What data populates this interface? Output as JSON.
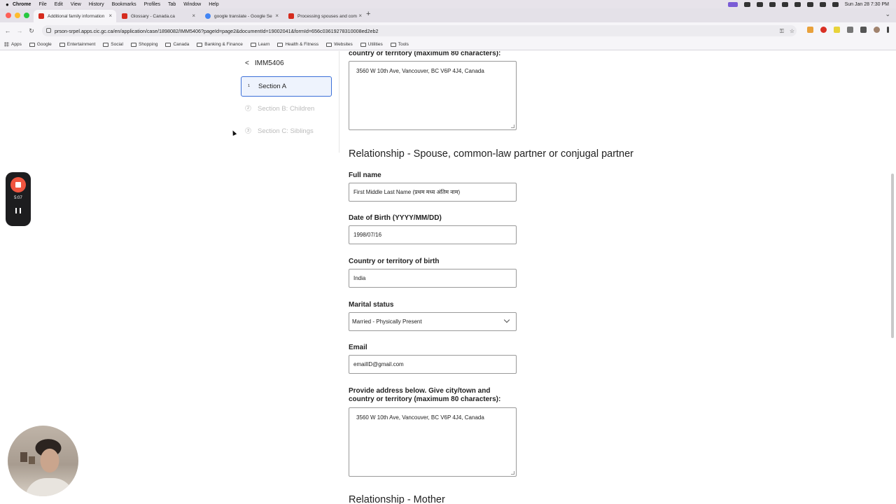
{
  "macbar": {
    "app": "Chrome",
    "menus": [
      "File",
      "Edit",
      "View",
      "History",
      "Bookmarks",
      "Profiles",
      "Tab",
      "Window",
      "Help"
    ],
    "clock": "Sun Jan 28  7:30 PM"
  },
  "tabs": [
    {
      "label": "Additional family information",
      "favicon_color": "#d52b1e"
    },
    {
      "label": "Glossary - Canada.ca",
      "favicon_color": "#d52b1e"
    },
    {
      "label": "google translate - Google Se",
      "favicon_color": "#4285f4"
    },
    {
      "label": "Processing spouses and com",
      "favicon_color": "#d52b1e"
    }
  ],
  "url": "prson-srpel.apps.cic.gc.ca/en/application/case/1898082/IMM5406?pageId=page2&documentId=19002041&formId=656c03619278310008ed2eb2",
  "bookmarks": [
    "Apps",
    "Google",
    "Entertainment",
    "Social",
    "Shopping",
    "Canada",
    "Learn",
    "Banking & Finance",
    "Health & Fitness",
    "Websites",
    "Utilities",
    "Tools"
  ],
  "sidebar": {
    "back_label": "IMM5406",
    "steps": [
      {
        "num": "1",
        "label": "Section A"
      },
      {
        "num": "2",
        "label": "Section B: Children"
      },
      {
        "num": "3",
        "label": "Section C: Siblings"
      }
    ]
  },
  "form": {
    "top_address_label": "country or territory (maximum 80 characters):",
    "top_address_value": "3560 W 10th Ave, Vancouver, BC V6P 4J4, Canada",
    "spouse_heading": "Relationship - Spouse, common-law partner or conjugal partner",
    "full_name_label": "Full name",
    "full_name_value": "First Middle Last Name (प्रथम मध्य अंतिम नाम)",
    "dob_label": "Date of Birth (YYYY/MM/DD)",
    "dob_value": "1998/07/16",
    "country_label": "Country or territory of birth",
    "country_value": "India",
    "marital_label": "Marital status",
    "marital_value": "Married - Physically Present",
    "email_label": "Email",
    "email_value": "emailID@gmail.com",
    "address_label_1": "Provide address below. Give city/town and",
    "address_label_2": "country or territory (maximum 80 characters):",
    "address_value": "3560 W 10th Ave, Vancouver, BC V6P 4J4, Canada",
    "mother_heading": "Relationship - Mother"
  },
  "recorder": {
    "time": "5:07",
    "accent": "#f0553f"
  }
}
